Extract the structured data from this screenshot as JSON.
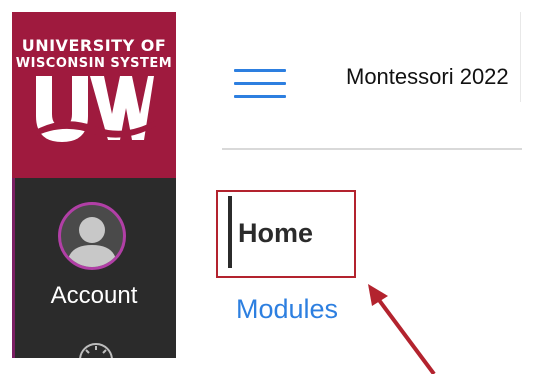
{
  "logo": {
    "line1": "UNIVERSITY OF",
    "line2": "WISCONSIN SYSTEM"
  },
  "sidebar": {
    "account_label": "Account"
  },
  "header": {
    "course_title": "Montessori 2022"
  },
  "course_nav": {
    "items": [
      {
        "label": "Home",
        "active": true
      },
      {
        "label": "Modules",
        "active": false
      }
    ]
  },
  "colors": {
    "brand_red": "#9f1a3e",
    "nav_dark": "#2b2b2b",
    "link_blue": "#2d7fe0",
    "highlight": "#b3232e",
    "avatar_ring": "#b13fa6"
  },
  "icons": [
    "uw-logo",
    "avatar-icon",
    "dashboard-icon",
    "hamburger-icon",
    "annotation-arrow"
  ]
}
